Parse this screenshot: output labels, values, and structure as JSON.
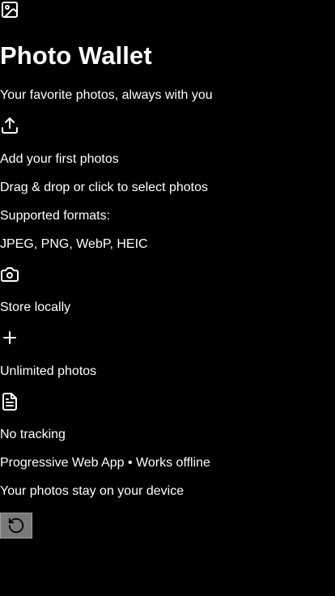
{
  "app": {
    "title": "Photo Wallet",
    "tagline": "Your favorite photos, always with you"
  },
  "upload": {
    "heading": "Add your first photos",
    "hint": "Drag & drop or click to select photos",
    "formats_label": "Supported formats:",
    "formats_value": "JPEG, PNG, WebP, HEIC"
  },
  "features": [
    {
      "icon": "camera-icon",
      "label": "Store locally"
    },
    {
      "icon": "plus-icon",
      "label": "Unlimited photos"
    },
    {
      "icon": "document-icon",
      "label": "No tracking"
    }
  ],
  "footer": {
    "line1": "Progressive Web App • Works offline",
    "line2": "Your photos stay on your device"
  },
  "controls": {
    "reset_icon": "reset-icon"
  },
  "colors": {
    "background": "#000000",
    "text": "#ffffff",
    "button_bg": "#7a7a7a"
  }
}
